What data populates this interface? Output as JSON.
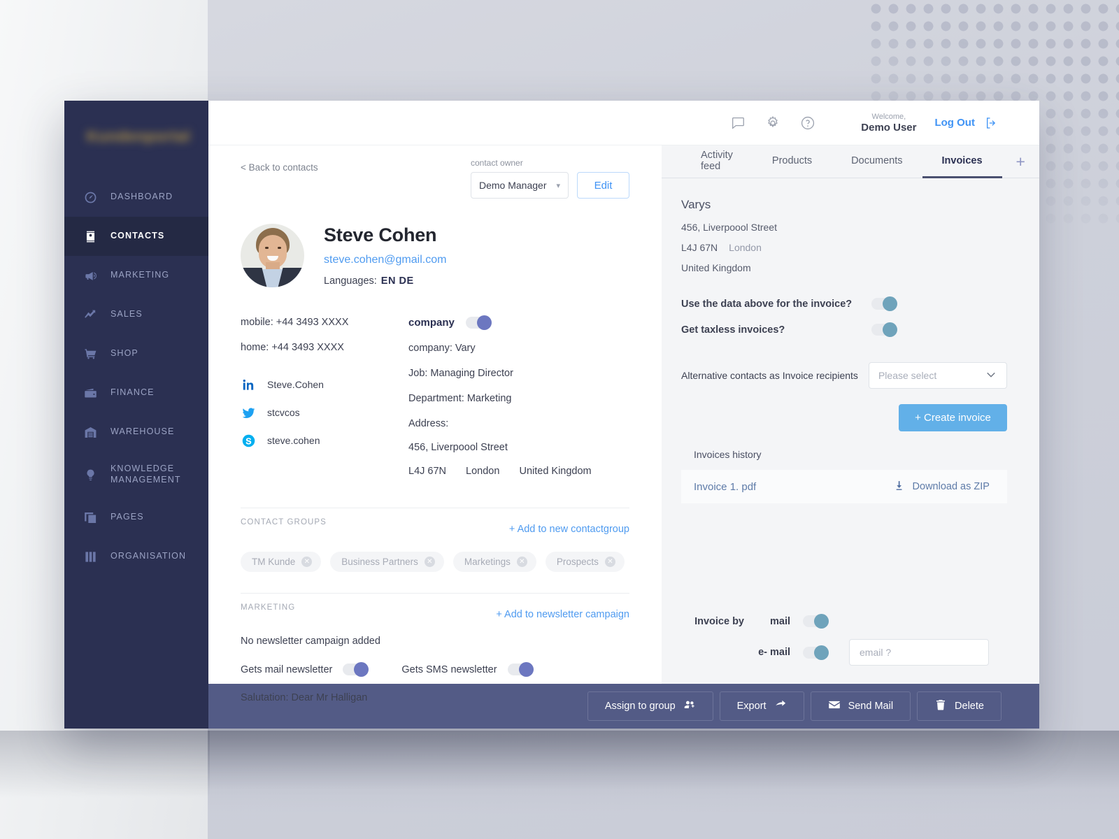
{
  "sidebar": {
    "logo_text": "Kundenportal",
    "items": [
      {
        "label": "DASHBOARD",
        "icon": "dashboard-icon",
        "active": false
      },
      {
        "label": "CONTACTS",
        "icon": "contacts-icon",
        "active": true
      },
      {
        "label": "MARKETING",
        "icon": "megaphone-icon",
        "active": false
      },
      {
        "label": "SALES",
        "icon": "trend-line-icon",
        "active": false
      },
      {
        "label": "SHOP",
        "icon": "shopping-cart-icon",
        "active": false
      },
      {
        "label": "FINANCE",
        "icon": "wallet-icon",
        "active": false
      },
      {
        "label": "WAREHOUSE",
        "icon": "warehouse-icon",
        "active": false
      },
      {
        "label": "KNOWLEDGE MANAGEMENT",
        "icon": "lightbulb-icon",
        "active": false
      },
      {
        "label": "PAGES",
        "icon": "pages-icon",
        "active": false
      },
      {
        "label": "ORGANISATION",
        "icon": "binders-icon",
        "active": false
      }
    ]
  },
  "topbar": {
    "welcome_small": "Welcome,",
    "welcome_name": "Demo User",
    "logout_label": "Log Out",
    "icons": [
      "chat-bubble-icon",
      "gear-icon",
      "help-circle-icon",
      "logout-arrow-icon"
    ]
  },
  "toolbar": {
    "back_label": "< Back to contacts",
    "owner_label": "contact owner",
    "owner_value": "Demo Manager",
    "edit_label": "Edit"
  },
  "profile": {
    "name": "Steve Cohen",
    "email": "steve.cohen@gmail.com",
    "languages_label": "Languages:",
    "languages_value": "EN  DE"
  },
  "contact_details": {
    "mobile": "mobile:  +44 3493 XXXX",
    "home": "home:  +44 3493 XXXX",
    "social": [
      {
        "network": "linkedin-icon",
        "handle": "Steve.Cohen"
      },
      {
        "network": "twitter-icon",
        "handle": "stcvcos"
      },
      {
        "network": "skype-icon",
        "handle": "steve.cohen"
      }
    ],
    "company_toggle_label": "company",
    "company": "company:  Vary",
    "job": "Job: Managing Director",
    "department": "Department: Marketing",
    "address_label": "Address:",
    "address_street": "456, Liverpoool Street",
    "address_zip": "L4J 67N",
    "address_city": "London",
    "address_country": "United Kingdom"
  },
  "contact_groups": {
    "section_title": "CONTACT GROUPS",
    "add_label": "+ Add to new contactgroup",
    "chips": [
      "TM Kunde",
      "Business Partners",
      "Marketings",
      "Prospects"
    ]
  },
  "marketing": {
    "section_title": "MARKETING",
    "add_label": "+ Add  to newsletter campaign",
    "note": "No newsletter campaign added",
    "mail_newsletter_label": "Gets mail newsletter",
    "sms_newsletter_label": "Gets SMS newsletter",
    "salutation": "Salutation: Dear Mr Halligan"
  },
  "panel": {
    "tabs": [
      {
        "label": "Activity feed",
        "active": false
      },
      {
        "label": "Products",
        "active": false
      },
      {
        "label": "Documents",
        "active": false
      },
      {
        "label": "Invoices",
        "active": true
      }
    ],
    "tab_add_label": "+",
    "billing_name": "Varys",
    "billing_street": "456, Liverpoool Street",
    "billing_zip": "L4J 67N",
    "billing_city": "London",
    "billing_country": "United Kingdom",
    "question_use_data": "Use the data above for the invoice?",
    "question_taxless": "Get taxless invoices?",
    "alt_contacts_label": "Alternative contacts as Invoice recipients",
    "alt_contacts_value": "Please select",
    "create_invoice_label": "+ Create invoice",
    "history_title": "Invoices history",
    "history_rows": [
      {
        "name": "Invoice 1. pdf",
        "action": "Download as ZIP"
      }
    ],
    "invoice_by_label": "Invoice by",
    "invoice_by_mail": "mail",
    "invoice_by_email": "e- mail",
    "email_placeholder": "email ?"
  },
  "actionbar": {
    "buttons": [
      {
        "label": "Assign to group",
        "icon": "add-people-icon"
      },
      {
        "label": "Export",
        "icon": "arrow-right-icon"
      },
      {
        "label": "Send Mail",
        "icon": "envelope-icon"
      },
      {
        "label": "Delete",
        "icon": "trash-icon"
      }
    ]
  },
  "colors": {
    "sidebar_bg": "#2b3052",
    "accent_blue": "#4f9bf0",
    "create_button": "#62b0e8",
    "toggle_purple": "#6c77c0",
    "toggle_teal": "#6fa3bb",
    "actionbar_bg": "#535b86"
  }
}
